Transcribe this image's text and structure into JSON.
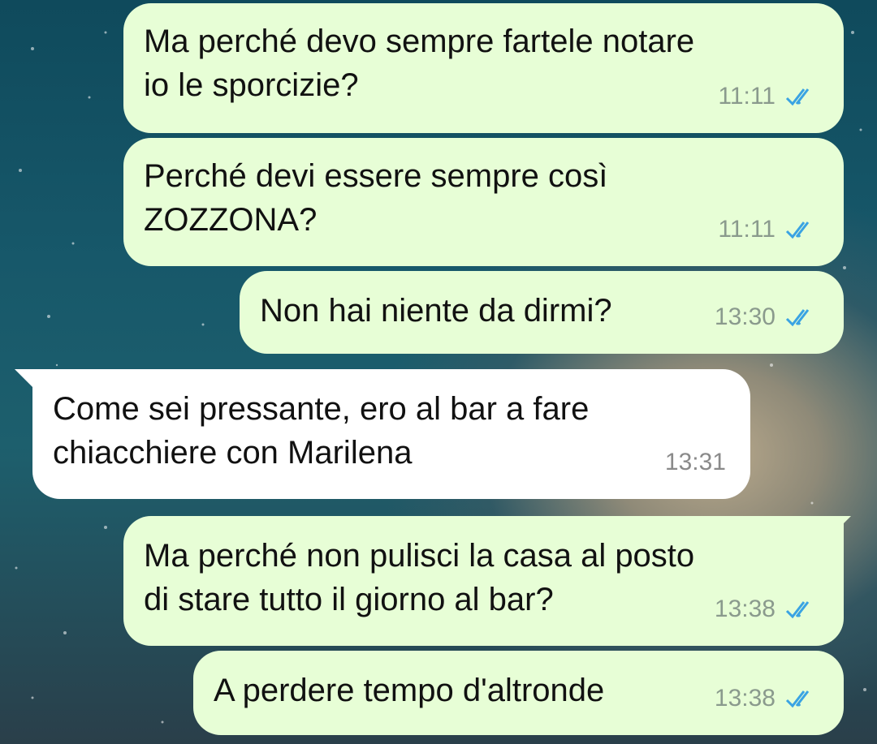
{
  "messages": [
    {
      "direction": "outgoing",
      "text": "Ma perché devo sempre fartele notare\nio le sporcizie?",
      "time": "11:11",
      "status_icon": "double-check-read-icon"
    },
    {
      "direction": "outgoing",
      "text": "Perché devi essere sempre così\nZOZZONA?",
      "time": "11:11",
      "status_icon": "double-check-read-icon"
    },
    {
      "direction": "outgoing",
      "text": "Non hai niente da dirmi?",
      "time": "13:30",
      "status_icon": "double-check-read-icon"
    },
    {
      "direction": "incoming",
      "text": "Come sei pressante, ero al bar a fare\nchiacchiere con Marilena",
      "time": "13:31"
    },
    {
      "direction": "outgoing",
      "text": "Ma perché non pulisci la casa al posto\ndi stare tutto il giorno al bar?",
      "time": "13:38",
      "status_icon": "double-check-read-icon"
    },
    {
      "direction": "outgoing",
      "text": "A perdere tempo d'altronde",
      "time": "13:38",
      "status_icon": "double-check-read-icon"
    }
  ],
  "colors": {
    "outgoing_bubble": "#e7fed6",
    "incoming_bubble": "#ffffff",
    "read_tick": "#3aa3e3"
  }
}
